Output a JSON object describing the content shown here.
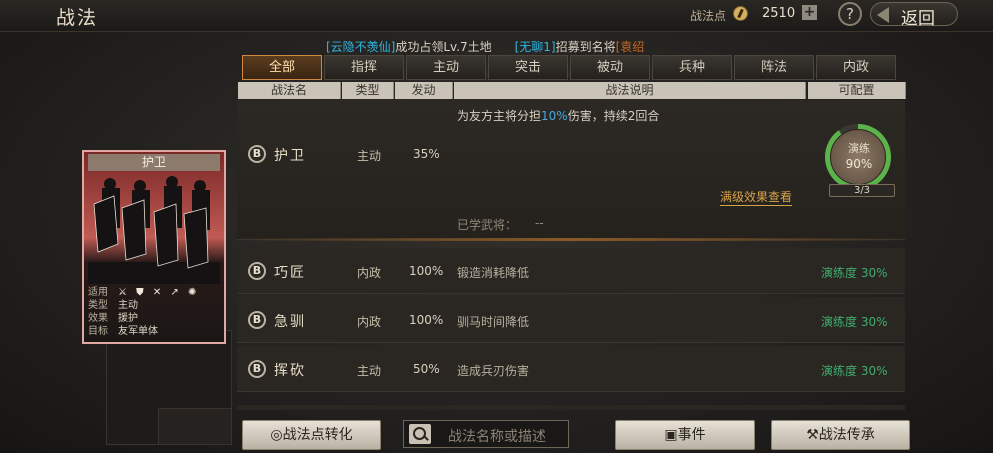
{
  "header": {
    "title": "战法",
    "points_label": "战法点",
    "points_value": "2510",
    "add_label": "+",
    "help_label": "?",
    "back_label": "返回"
  },
  "broadcast": {
    "p1": "[云隐不羡仙]",
    "p2": "成功占领Lv.7土地",
    "p3": "[无聊1]",
    "p4": "招募到名将",
    "p5": "[袁绍"
  },
  "tabs": [
    "全部",
    "指挥",
    "主动",
    "突击",
    "被动",
    "兵种",
    "阵法",
    "内政"
  ],
  "columns": [
    "战法名",
    "类型",
    "发动",
    "战法说明",
    "可配置"
  ],
  "expanded": {
    "grade": "B",
    "name": "护卫",
    "type": "主动",
    "rate": "35%",
    "desc_a": "为友方主将分担",
    "desc_hl": "10%",
    "desc_b": "伤害，持续2回合",
    "ring_label": "演练",
    "ring_pct": "90%",
    "count": "3/3",
    "full_view": "满级效果查看",
    "learned_label": "已学武将：",
    "learned_value": "--"
  },
  "rows": [
    {
      "grade": "B",
      "name": "巧匠",
      "type": "内政",
      "rate": "100%",
      "desc": "锻造消耗降低",
      "progress": "演练度 30%"
    },
    {
      "grade": "B",
      "name": "急驯",
      "type": "内政",
      "rate": "100%",
      "desc": "驯马时间降低",
      "progress": "演练度 30%"
    },
    {
      "grade": "B",
      "name": "挥砍",
      "type": "主动",
      "rate": "50%",
      "desc": "造成兵刃伤害",
      "progress": "演练度 30%"
    }
  ],
  "card": {
    "title": "护卫",
    "k_use": "适用",
    "units": "⚔ ⛊ ✕ ↗ ✺",
    "k_type": "类型",
    "v_type": "主动",
    "k_effect": "效果",
    "v_effect": "援护",
    "k_target": "目标",
    "v_target": "友军单体"
  },
  "bottom": {
    "convert_label": "战法点转化",
    "search_placeholder": "战法名称或描述",
    "event_label": "事件",
    "inherit_label": "战法传承"
  },
  "colors": {
    "accent": "#d08a40",
    "progress": "#3fae6e",
    "highlight": "#48a8e0",
    "card_border": "#e0a8a0"
  }
}
